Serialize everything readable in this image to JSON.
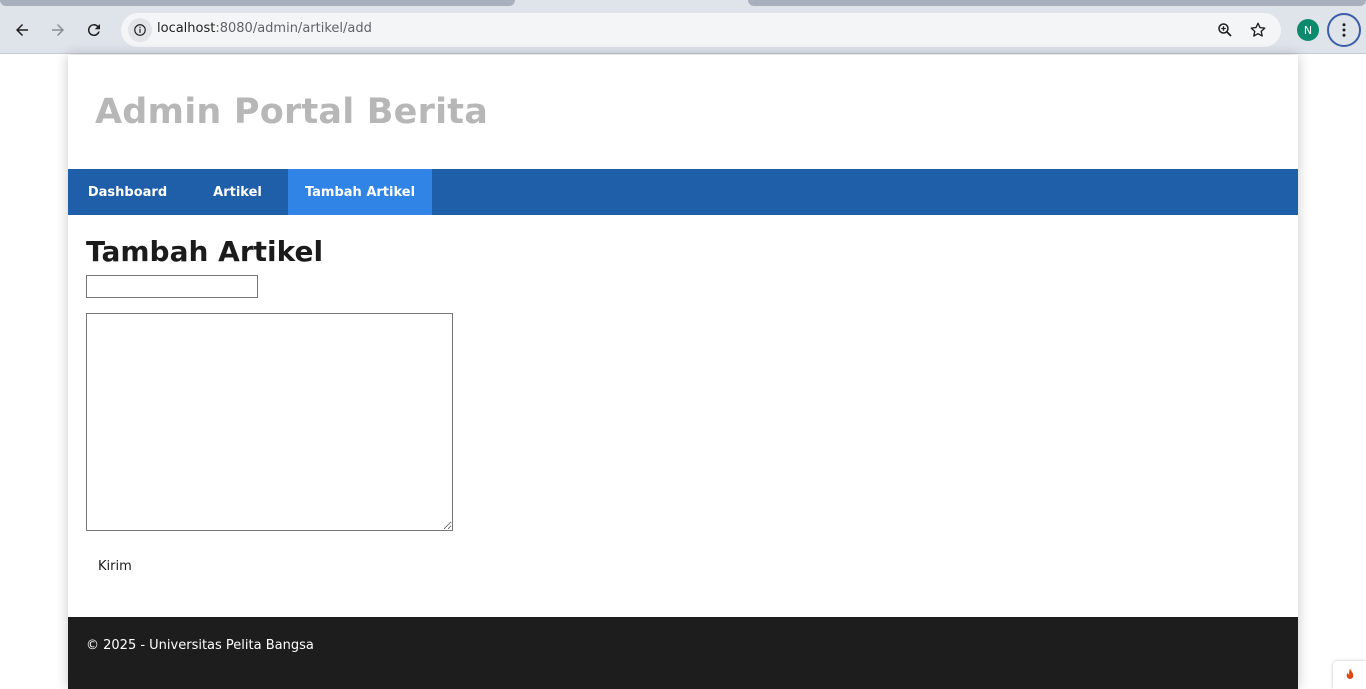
{
  "browser": {
    "url_host": "localhost",
    "url_rest": ":8080/admin/artikel/add",
    "profile_initial": "N"
  },
  "header": {
    "site_title": "Admin Portal Berita"
  },
  "nav": {
    "items": [
      {
        "label": "Dashboard",
        "active": false
      },
      {
        "label": "Artikel",
        "active": false
      },
      {
        "label": "Tambah Artikel",
        "active": true
      }
    ]
  },
  "form": {
    "page_title": "Tambah Artikel",
    "title_value": "",
    "content_value": "",
    "submit_label": "Kirim"
  },
  "footer": {
    "text": "© 2025 - Universitas Pelita Bangsa"
  },
  "colors": {
    "nav_bg": "#1f5fa9",
    "nav_active": "#2f84e6",
    "footer_bg": "#1d1d1d",
    "title_grey": "#b7b7b7"
  }
}
